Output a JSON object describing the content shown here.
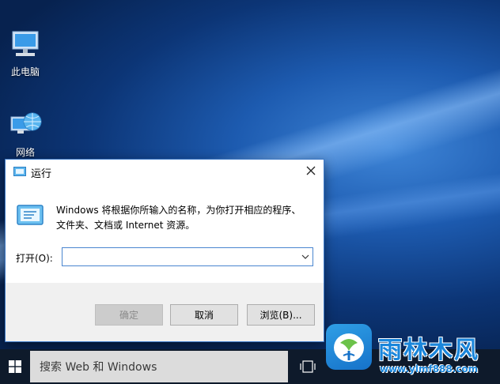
{
  "desktop": {
    "icons": [
      {
        "label": "此电脑"
      },
      {
        "label": "网络"
      }
    ]
  },
  "run_dialog": {
    "title": "运行",
    "description_line1": "Windows 将根据你所输入的名称，为你打开相应的程序、",
    "description_line2": "文件夹、文档或 Internet 资源。",
    "open_label": "打开(O):",
    "open_value": "",
    "buttons": {
      "ok": "确定",
      "cancel": "取消",
      "browse": "浏览(B)..."
    }
  },
  "taskbar": {
    "search_placeholder": "搜索 Web 和 Windows"
  },
  "watermark": {
    "title": "雨林木风",
    "url": "www.ylmf888.com"
  },
  "colors": {
    "accent": "#3a78c8",
    "taskbar": "#0e1a2b",
    "watermark": "#1a86db"
  }
}
